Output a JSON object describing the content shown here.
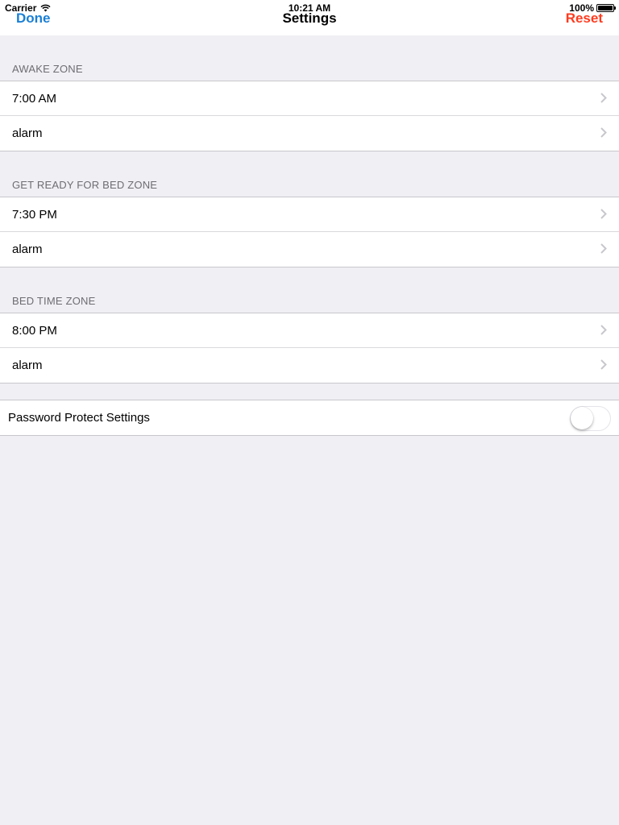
{
  "status_bar": {
    "carrier": "Carrier",
    "wifi_icon": "wifi-icon",
    "time": "10:21 AM",
    "battery_percent": "100%",
    "battery_icon": "battery-icon"
  },
  "nav": {
    "title": "Settings",
    "left_button": "Done",
    "right_button": "Reset",
    "left_color": "#1a7fd6",
    "right_color": "#ff3b1f"
  },
  "sections": [
    {
      "header": "AWAKE ZONE",
      "rows": [
        {
          "label": "7:00 AM",
          "icon": "chevron-right-icon"
        },
        {
          "label": "alarm",
          "icon": "chevron-right-icon"
        }
      ]
    },
    {
      "header": "GET READY FOR BED ZONE",
      "rows": [
        {
          "label": "7:30 PM",
          "icon": "chevron-right-icon"
        },
        {
          "label": "alarm",
          "icon": "chevron-right-icon"
        }
      ]
    },
    {
      "header": "BED TIME ZONE",
      "rows": [
        {
          "label": "8:00 PM",
          "icon": "chevron-right-icon"
        },
        {
          "label": "alarm",
          "icon": "chevron-right-icon"
        }
      ]
    }
  ],
  "password_protect": {
    "label": "Password Protect Settings",
    "enabled": false
  },
  "colors": {
    "background": "#efeff4",
    "cell": "#ffffff",
    "separator": "#c8c7cc",
    "header_text": "#6d6d72"
  }
}
